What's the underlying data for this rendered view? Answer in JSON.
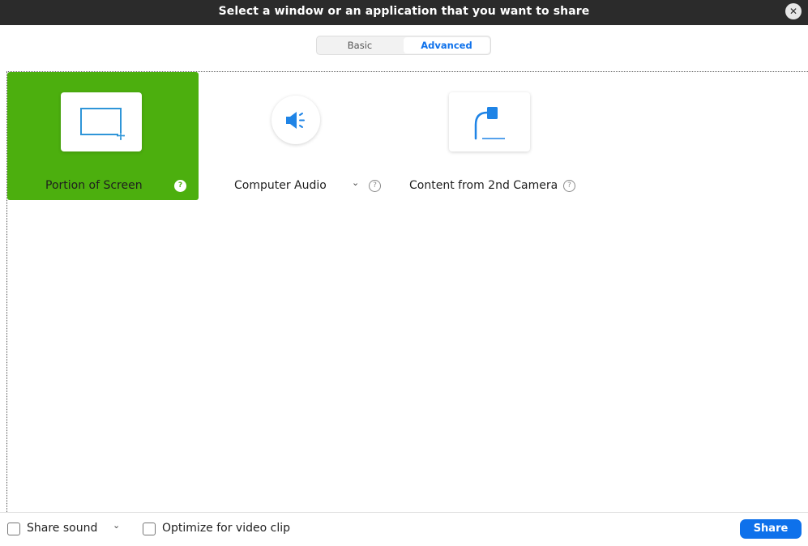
{
  "window": {
    "title": "Select a window or an application that you want to share",
    "close_label": "✕"
  },
  "tabs": [
    {
      "label": "Basic",
      "active": false
    },
    {
      "label": "Advanced",
      "active": true
    }
  ],
  "options": [
    {
      "label": "Portion of Screen",
      "icon": "portion-of-screen-icon",
      "selected": true
    },
    {
      "label": "Computer Audio",
      "icon": "speaker-icon",
      "selected": false,
      "has_dropdown": true
    },
    {
      "label": "Content from 2nd Camera",
      "icon": "document-camera-icon",
      "selected": false
    }
  ],
  "help_glyph": "?",
  "dropdown_glyph": "⌄",
  "footer": {
    "share_sound_label": "Share sound",
    "optimize_label": "Optimize for video clip",
    "share_button_label": "Share"
  },
  "colors": {
    "accent": "#0e71eb",
    "selected": "#4caf0e",
    "titlebar": "#2b2b2b"
  }
}
